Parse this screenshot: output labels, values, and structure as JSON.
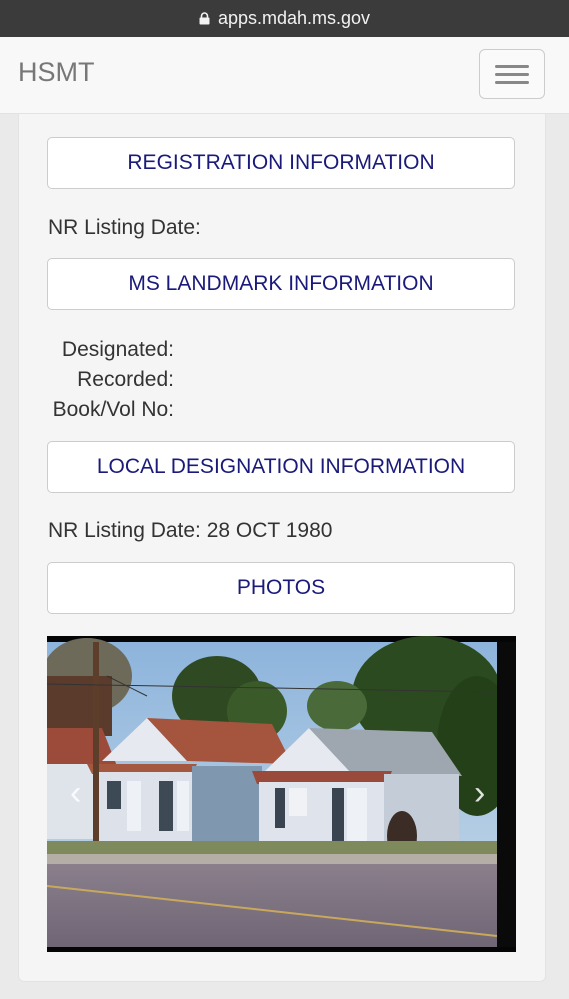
{
  "browser": {
    "url": "apps.mdah.ms.gov"
  },
  "navbar": {
    "brand": "HSMT"
  },
  "sections": {
    "registration": "REGISTRATION INFORMATION",
    "nr_listing_label": "NR Listing Date:",
    "landmark": "MS LANDMARK INFORMATION",
    "designated_label": "Designated:",
    "recorded_label": "Recorded:",
    "bookvol_label": "Book/Vol No:",
    "local": "LOCAL DESIGNATION INFORMATION",
    "local_nr_listing": "NR Listing Date: 28 OCT 1980",
    "photos": "PHOTOS"
  },
  "carousel": {
    "prev_icon": "chevron-left-icon",
    "next_icon": "chevron-right-icon",
    "image_subject": "photo of two small wooden shotgun houses with rusted tin roofs along a street"
  },
  "colors": {
    "link": "#1a1a7a",
    "panel": "#f5f5f5",
    "statusbar": "#3b3b3b"
  }
}
